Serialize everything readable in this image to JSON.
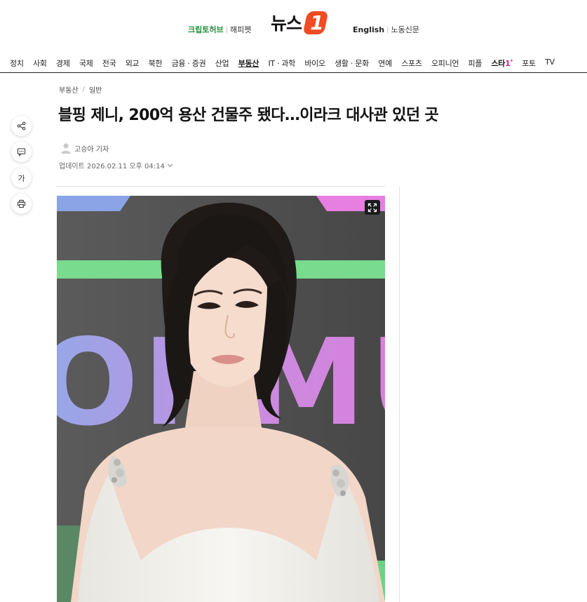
{
  "header": {
    "left_link_1": "크립토허브",
    "left_link_2": "해피펫",
    "logo_text": "뉴스",
    "logo_mark": "1",
    "right_link_1": "English",
    "right_link_2": "노동신문",
    "separator": "|"
  },
  "nav": {
    "items": [
      "정치",
      "사회",
      "경제",
      "국제",
      "전국",
      "외교",
      "북한",
      "금융 · 증권",
      "산업",
      "부동산",
      "IT · 과학",
      "바이오",
      "생활 · 문화",
      "연예",
      "스포츠",
      "오피니언",
      "피플",
      "스타1",
      "포토",
      "TV"
    ],
    "star_main": "스타",
    "star_accent": "1",
    "star_sup": "*",
    "active": "부동산"
  },
  "side_actions": {
    "share_icon": "share-icon",
    "comment_icon": "comment-icon",
    "font_label": "가",
    "print_icon": "print-icon"
  },
  "article": {
    "breadcrumb_1": "부동산",
    "breadcrumb_sep": "/",
    "breadcrumb_2": "일반",
    "headline": "블핑 제니, 200억 용산 건물주 됐다…이라크 대사관 있던 곳",
    "reporter": "고승아 기자",
    "updated": "업데이트 2026.02.11 오후 04:14"
  },
  "photo": {
    "expand_icon": "expand-icon",
    "background_letters": "ONMU"
  },
  "colors": {
    "brand_orange": "#f04b23",
    "green_link": "#1f8f3a",
    "star_pink": "#d61a9b"
  }
}
